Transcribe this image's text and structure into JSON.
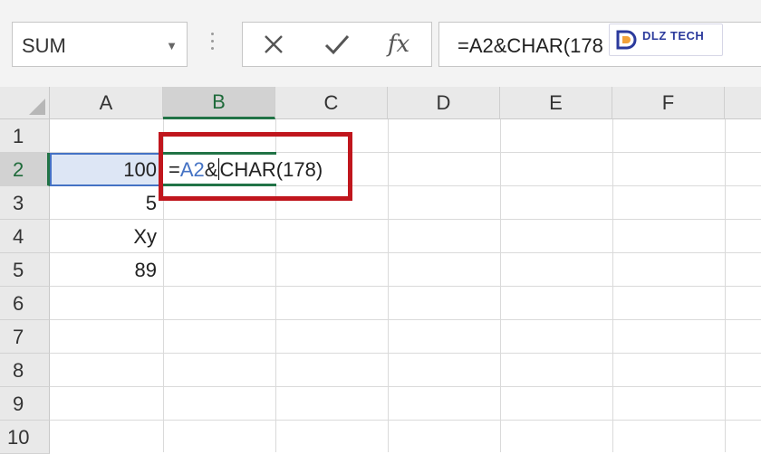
{
  "namebox": {
    "value": "SUM"
  },
  "formula_buttons": {
    "cancel": "cancel-icon",
    "enter": "checkmark-icon",
    "fx_label": "fx"
  },
  "formula_bar": {
    "value": "=A2&CHAR(178"
  },
  "watermark": {
    "brand": "DLZ TECH"
  },
  "columns": [
    "A",
    "B",
    "C",
    "D",
    "E",
    "F"
  ],
  "rows": [
    "1",
    "2",
    "3",
    "4",
    "5",
    "6",
    "7",
    "8",
    "9",
    "10"
  ],
  "cells": {
    "A2": "100",
    "A3": "5",
    "A4": "Xy",
    "A5": "89"
  },
  "editing_cell": {
    "ref": "B2",
    "prefix": "=",
    "reference": "A2",
    "operator": "&",
    "rest": "CHAR(178)"
  },
  "colors": {
    "highlight_box": "#c0161d",
    "excel_green": "#217346",
    "reference_blue": "#4472c4"
  }
}
